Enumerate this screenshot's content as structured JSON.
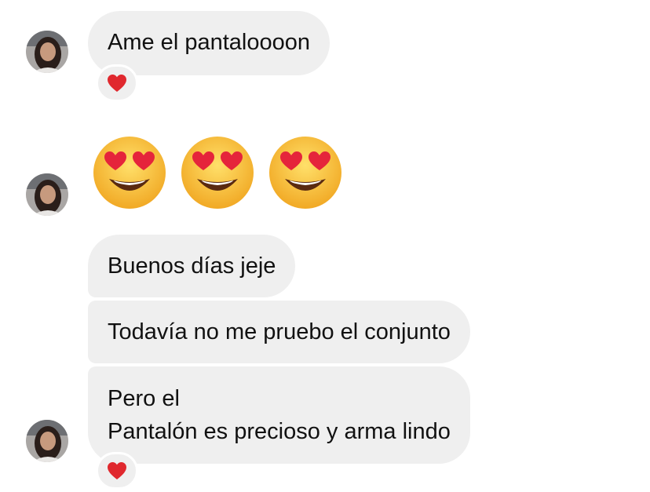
{
  "messages": [
    {
      "text": "Ame el pantaloooon",
      "reaction": "heart"
    },
    {
      "emojis": [
        "heart-eyes-emoji",
        "heart-eyes-emoji",
        "heart-eyes-emoji"
      ]
    },
    {
      "text": "Buenos días jeje"
    },
    {
      "text": "Todavía no me pruebo el conjunto"
    },
    {
      "lines": [
        "Pero el",
        "Pantalón es precioso y arma lindo"
      ],
      "reaction": "heart"
    }
  ],
  "colors": {
    "bubble": "#efefef",
    "text": "#111111",
    "heart": "#e0282e",
    "emoji_face": "#f7c33b"
  }
}
